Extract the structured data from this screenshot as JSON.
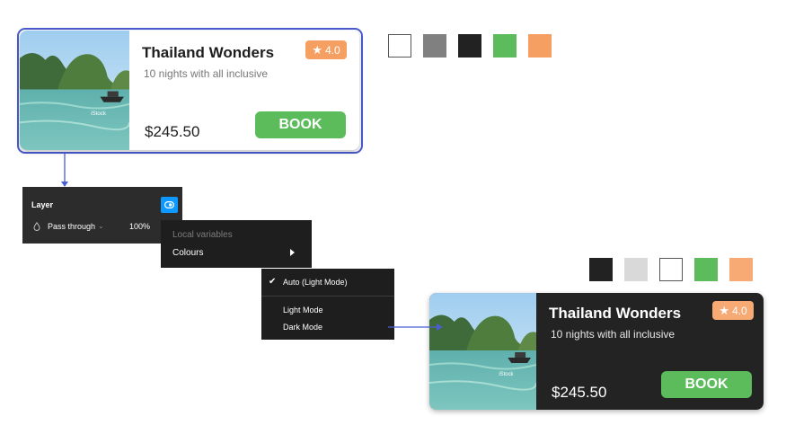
{
  "light_card": {
    "title": "Thailand Wonders",
    "subtitle": "10 nights with all inclusive",
    "price": "$245.50",
    "rating": "4.0",
    "book_label": "BOOK",
    "image_watermark": "iStock"
  },
  "dark_card": {
    "title": "Thailand Wonders",
    "subtitle": "10 nights with all inclusive",
    "price": "$245.50",
    "rating": "4.0",
    "book_label": "BOOK",
    "image_watermark": "iStock"
  },
  "light_swatches": [
    "#ffffff",
    "#808080",
    "#222222",
    "#5cbc5c",
    "#f5a062"
  ],
  "dark_swatches": [
    "#222222",
    "#d9d9d9",
    "#ffffff",
    "#5cbc5c",
    "#f7aa74"
  ],
  "layer_panel": {
    "title": "Layer",
    "blend_mode": "Pass through",
    "opacity": "100%",
    "variable_button_icon": "variable-mode-icon"
  },
  "variables_menu": {
    "heading": "Local variables",
    "item": "Colours"
  },
  "mode_menu": {
    "checked_item": "Auto (Light Mode)",
    "items": [
      "Light Mode",
      "Dark Mode"
    ]
  },
  "colors": {
    "selection": "#4a5dd1",
    "accent_blue": "#0d99ff",
    "book_green": "#5cbc5c",
    "badge_orange": "#f5a062",
    "dark_card_bg": "#232323",
    "menu_bg": "#1e1e1e"
  }
}
